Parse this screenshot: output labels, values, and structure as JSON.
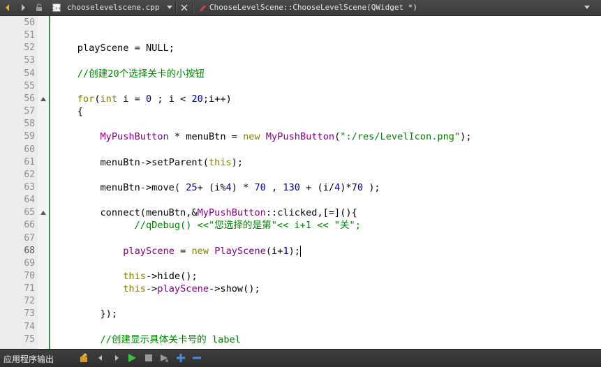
{
  "tabs": {
    "file_name": "chooselevelscene.cpp",
    "symbol_name": "ChooseLevelScene::ChooseLevelScene(QWidget *)"
  },
  "editor": {
    "current_line": 68,
    "lines": [
      {
        "num": "50",
        "segs": []
      },
      {
        "num": "51",
        "segs": []
      },
      {
        "num": "52",
        "segs": [
          {
            "t": "    playScene = ",
            "c": ""
          },
          {
            "t": "NULL",
            "c": ""
          },
          {
            "t": ";",
            "c": ""
          }
        ]
      },
      {
        "num": "53",
        "segs": []
      },
      {
        "num": "54",
        "segs": [
          {
            "t": "    //创建20个选择关卡的小按钮",
            "c": "cm"
          }
        ]
      },
      {
        "num": "55",
        "segs": []
      },
      {
        "num": "56",
        "segs": [
          {
            "t": "    ",
            "c": ""
          },
          {
            "t": "for",
            "c": "kw"
          },
          {
            "t": "(",
            "c": ""
          },
          {
            "t": "int",
            "c": "kw"
          },
          {
            "t": " i = ",
            "c": ""
          },
          {
            "t": "0",
            "c": "num"
          },
          {
            "t": " ; i < ",
            "c": ""
          },
          {
            "t": "20",
            "c": "num"
          },
          {
            "t": ";i++)",
            "c": ""
          }
        ]
      },
      {
        "num": "57",
        "segs": [
          {
            "t": "    {",
            "c": ""
          }
        ]
      },
      {
        "num": "58",
        "segs": []
      },
      {
        "num": "59",
        "segs": [
          {
            "t": "        ",
            "c": ""
          },
          {
            "t": "MyPushButton",
            "c": "ty"
          },
          {
            "t": " * menuBtn = ",
            "c": ""
          },
          {
            "t": "new",
            "c": "kw"
          },
          {
            "t": " ",
            "c": ""
          },
          {
            "t": "MyPushButton",
            "c": "ty"
          },
          {
            "t": "(",
            "c": ""
          },
          {
            "t": "\":/res/LevelIcon.png\"",
            "c": "str"
          },
          {
            "t": ");",
            "c": ""
          }
        ]
      },
      {
        "num": "60",
        "segs": []
      },
      {
        "num": "61",
        "segs": [
          {
            "t": "        menuBtn->setParent(",
            "c": ""
          },
          {
            "t": "this",
            "c": "kw"
          },
          {
            "t": ");",
            "c": ""
          }
        ]
      },
      {
        "num": "62",
        "segs": []
      },
      {
        "num": "63",
        "segs": [
          {
            "t": "        menuBtn->move( ",
            "c": ""
          },
          {
            "t": "25",
            "c": "num"
          },
          {
            "t": "+ (i%",
            "c": ""
          },
          {
            "t": "4",
            "c": "num"
          },
          {
            "t": ") * ",
            "c": ""
          },
          {
            "t": "70",
            "c": "num"
          },
          {
            "t": " , ",
            "c": ""
          },
          {
            "t": "130",
            "c": "num"
          },
          {
            "t": " + (i/",
            "c": ""
          },
          {
            "t": "4",
            "c": "num"
          },
          {
            "t": ")*",
            "c": ""
          },
          {
            "t": "70",
            "c": "num"
          },
          {
            "t": " );",
            "c": ""
          }
        ]
      },
      {
        "num": "64",
        "segs": []
      },
      {
        "num": "65",
        "segs": [
          {
            "t": "        connect(menuBtn,&",
            "c": ""
          },
          {
            "t": "MyPushButton",
            "c": "ty"
          },
          {
            "t": "::clicked,[=](){",
            "c": ""
          }
        ]
      },
      {
        "num": "66",
        "segs": [
          {
            "t": "              //qDebug() <<\"您选择的是第\"<< i+1 << \"关\";",
            "c": "cm"
          }
        ]
      },
      {
        "num": "67",
        "segs": []
      },
      {
        "num": "68",
        "segs": [
          {
            "t": "            ",
            "c": ""
          },
          {
            "t": "playScene",
            "c": "ty"
          },
          {
            "t": " = ",
            "c": ""
          },
          {
            "t": "new",
            "c": "kw"
          },
          {
            "t": " ",
            "c": ""
          },
          {
            "t": "PlayScene",
            "c": "ty"
          },
          {
            "t": "(i+",
            "c": ""
          },
          {
            "t": "1",
            "c": "num"
          },
          {
            "t": ");",
            "c": ""
          }
        ]
      },
      {
        "num": "69",
        "segs": []
      },
      {
        "num": "70",
        "segs": [
          {
            "t": "            ",
            "c": ""
          },
          {
            "t": "this",
            "c": "kw"
          },
          {
            "t": "->hide();",
            "c": ""
          }
        ]
      },
      {
        "num": "71",
        "segs": [
          {
            "t": "            ",
            "c": ""
          },
          {
            "t": "this",
            "c": "kw"
          },
          {
            "t": "->",
            "c": ""
          },
          {
            "t": "playScene",
            "c": "ty"
          },
          {
            "t": "->show();",
            "c": ""
          }
        ]
      },
      {
        "num": "72",
        "segs": []
      },
      {
        "num": "73",
        "segs": [
          {
            "t": "        });",
            "c": ""
          }
        ]
      },
      {
        "num": "74",
        "segs": []
      },
      {
        "num": "75",
        "segs": [
          {
            "t": "        //创建显示具体关卡号的 label",
            "c": "cm"
          }
        ]
      }
    ]
  },
  "output_pane": {
    "title": "应用程序输出"
  },
  "colors": {
    "keyword": "#808000",
    "type": "#800080",
    "number": "#000080",
    "string": "#008000",
    "comment": "#008000"
  }
}
